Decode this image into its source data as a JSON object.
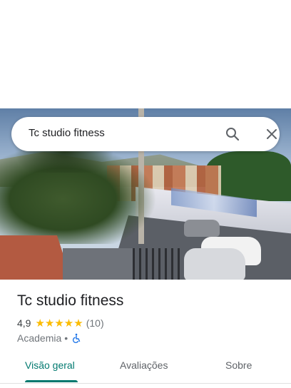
{
  "search": {
    "query": "Tc studio fitness",
    "search_icon": "search-icon",
    "close_icon": "close-icon"
  },
  "place": {
    "name": "Tc studio fitness",
    "rating": "4,9",
    "stars": "★★★★★",
    "review_count": "(10)",
    "category": "Academia",
    "separator": "•",
    "accessibility_icon": "wheelchair-icon"
  },
  "tabs": [
    {
      "label": "Visão geral",
      "active": true
    },
    {
      "label": "Avaliações",
      "active": false
    },
    {
      "label": "Sobre",
      "active": false
    }
  ],
  "colors": {
    "accent": "#01796f",
    "star": "#fbbc04",
    "accessibility": "#1a73e8"
  }
}
